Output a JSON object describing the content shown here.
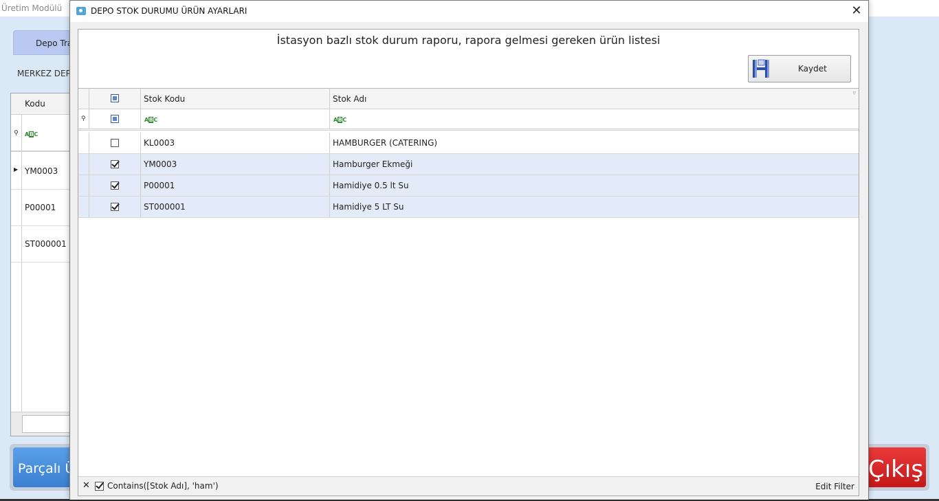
{
  "background": {
    "app_title": "Üretim Modülü",
    "tab_label": "Depo Tra",
    "merkez_label": "MERKEZ DEPO",
    "grid_header": "Kodu",
    "rows": [
      "YM0003",
      "P00001",
      "ST000001"
    ],
    "blue_button": "Parçalı Ürü",
    "red_button": "Çıkış"
  },
  "dialog": {
    "title": "DEPO STOK DURUMU ÜRÜN AYARLARI",
    "heading": "İstasyon bazlı stok durum raporu, rapora gelmesi gereken ürün listesi",
    "save_label": "Kaydet",
    "columns": {
      "kod": "Stok Kodu",
      "ad": "Stok Adı"
    },
    "rows": [
      {
        "checked": false,
        "kod": "KL0003",
        "ad": "HAMBURGER (CATERING)"
      },
      {
        "checked": true,
        "kod": "YM0003",
        "ad": "Hamburger Ekmeği"
      },
      {
        "checked": true,
        "kod": "P00001",
        "ad": "Hamidiye 0.5 lt Su"
      },
      {
        "checked": true,
        "kod": "ST000001",
        "ad": "Hamidiye 5 LT Su"
      }
    ],
    "filter_text": "Contains([Stok Adı], 'ham')",
    "edit_filter": "Edit Filter"
  },
  "colors": {
    "selected_row": "#e4ebf8",
    "save_icon": "#2f4fa6",
    "exit_red": "#d42424",
    "blue_btn": "#4a90e2"
  },
  "icons": {
    "close": "close-icon",
    "abc": "text-filter-icon",
    "pin": "pin-icon"
  }
}
